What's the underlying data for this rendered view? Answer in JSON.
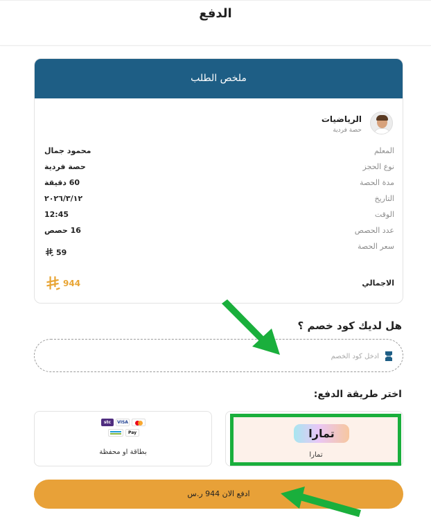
{
  "page": {
    "title": "الدفع"
  },
  "summary": {
    "header": "ملخص الطلب",
    "subject_name": "الرياضيات",
    "subject_type": "حصة فردية",
    "rows": [
      {
        "label": "المعلم",
        "value": "محمود جمال"
      },
      {
        "label": "نوع الحجز",
        "value": "حصة فردية"
      },
      {
        "label": "مدة الحصة",
        "value": "60 دقيقة"
      },
      {
        "label": "التاريخ",
        "value": "٢٠٢٦/٣/١٢"
      },
      {
        "label": "الوقت",
        "value": "12:45"
      },
      {
        "label": "عدد الحصص",
        "value": "16 حصص"
      },
      {
        "label": "سعر الحصة",
        "value": "59"
      }
    ],
    "total_label": "الاجمالي",
    "total_value": "944"
  },
  "discount": {
    "title": "هل لديك كود خصم ؟",
    "placeholder": "ادخل كود الخصم"
  },
  "payment": {
    "title": "اختر طريقة الدفع:",
    "methods": [
      {
        "label": "تمارا",
        "logo_text": "تمارا",
        "icon": "tamara-logo"
      },
      {
        "label": "بطاقة او محفظة",
        "icons": [
          "stc-pay-icon",
          "visa-icon",
          "mastercard-icon",
          "mada-icon",
          "apple-pay-icon"
        ]
      }
    ],
    "icon_labels": {
      "stc": "stc",
      "visa": "VISA",
      "apay": "Pay"
    }
  },
  "pay_button": {
    "label": "ادفع الان 944 ر.س"
  },
  "colors": {
    "header_bg": "#1e5e85",
    "accent": "#e8a138",
    "highlight_green": "#1aaf3c",
    "tamara_bg": "#fdf1ea"
  }
}
